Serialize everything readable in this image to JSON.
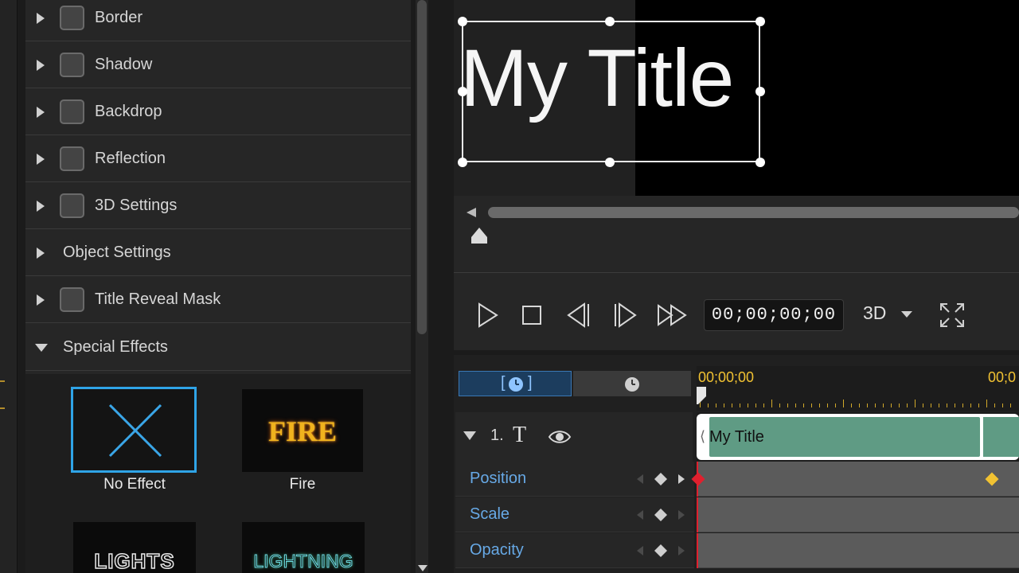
{
  "properties": {
    "rows": [
      {
        "label": "Border",
        "has_checkbox": true,
        "expanded": false
      },
      {
        "label": "Shadow",
        "has_checkbox": true,
        "expanded": false
      },
      {
        "label": "Backdrop",
        "has_checkbox": true,
        "expanded": false
      },
      {
        "label": "Reflection",
        "has_checkbox": true,
        "expanded": false
      },
      {
        "label": "3D Settings",
        "has_checkbox": true,
        "expanded": false
      },
      {
        "label": "Object Settings",
        "has_checkbox": false,
        "expanded": false
      },
      {
        "label": "Title Reveal Mask",
        "has_checkbox": true,
        "expanded": false
      },
      {
        "label": "Special Effects",
        "has_checkbox": false,
        "expanded": true
      }
    ],
    "effects": [
      {
        "name": "No Effect",
        "selected": true,
        "icon": "no-effect-x-icon"
      },
      {
        "name": "Fire",
        "selected": false,
        "thumb_text": "FIRE"
      },
      {
        "name": "Lights",
        "selected": false,
        "thumb_text": "LIGHTS"
      },
      {
        "name": "Lightning",
        "selected": false,
        "thumb_text": "LIGHTNING"
      }
    ]
  },
  "preview": {
    "title_text": "My Title",
    "timecode": "00;00;00;00",
    "mode": "3D"
  },
  "timeline": {
    "ruler_start": "00;00;00",
    "ruler_next": "00;0",
    "track": {
      "number": "1.",
      "type_glyph": "T",
      "clip_label": "My Title"
    },
    "attributes": [
      {
        "name": "Position",
        "keyframe_end": true
      },
      {
        "name": "Scale",
        "keyframe_end": false
      },
      {
        "name": "Opacity",
        "keyframe_end": false
      }
    ]
  },
  "colors": {
    "accent_blue": "#2fa4e7",
    "timecode_yellow": "#f1c232",
    "clip_green": "#5f9b84",
    "attr_blue": "#67a9e6",
    "playhead_red": "#e0202e"
  }
}
